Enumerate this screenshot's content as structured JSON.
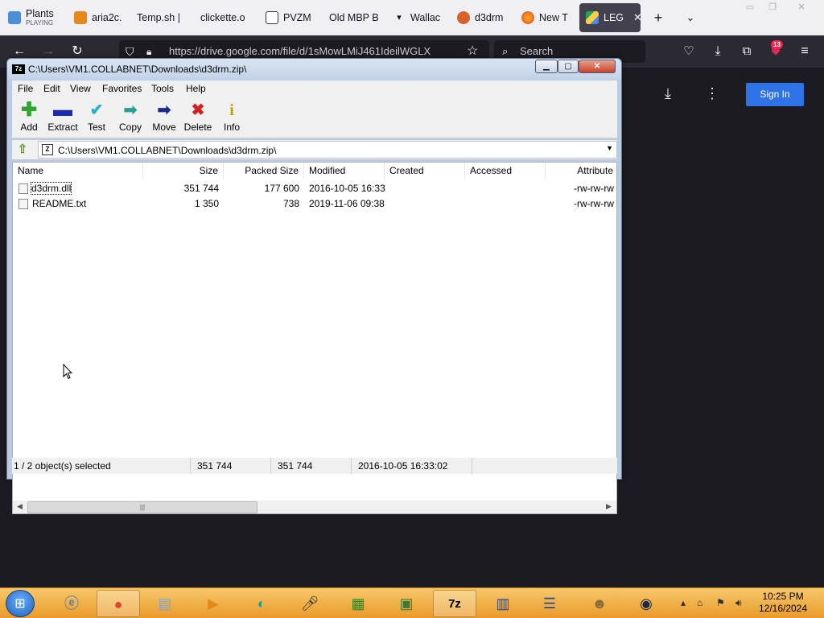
{
  "browser": {
    "tabs": [
      {
        "label": "Plants",
        "sublabel": "PLAYING",
        "icon": "game-icon",
        "active": false
      },
      {
        "label": "aria2c.",
        "icon": "shield-icon",
        "active": false
      },
      {
        "label": "Temp.sh | ",
        "icon": "none",
        "active": false
      },
      {
        "label": "clickette.o",
        "icon": "none",
        "active": false
      },
      {
        "label": "PVZM",
        "icon": "binary-icon",
        "active": false
      },
      {
        "label": "Old MBP B",
        "icon": "none",
        "active": false
      },
      {
        "label": "Wallac",
        "icon": "bird-icon",
        "active": false
      },
      {
        "label": "d3drm",
        "icon": "gear-icon",
        "active": false
      },
      {
        "label": "New T",
        "icon": "firefox-icon",
        "active": false
      },
      {
        "label": "LEG",
        "icon": "drive-icon",
        "active": true
      }
    ],
    "url": "https://drive.google.com/file/d/1sMowLMiJ461IdeilWGLX",
    "search_placeholder": "Search",
    "extensions_badge": "13"
  },
  "page": {
    "signin_label": "Sign In"
  },
  "sevenzip": {
    "title": "C:\\Users\\VM1.COLLABNET\\Downloads\\d3drm.zip\\",
    "app_icon_text": "7z",
    "menu": [
      "File",
      "Edit",
      "View",
      "Favorites",
      "Tools",
      "Help"
    ],
    "toolbar": [
      {
        "label": "Add",
        "icon": "plus-icon",
        "color": "#2fa52f"
      },
      {
        "label": "Extract",
        "icon": "minus-icon",
        "color": "#1a2aa8"
      },
      {
        "label": "Test",
        "icon": "checkmark-icon",
        "color": "#2bb0c9"
      },
      {
        "label": "Copy",
        "icon": "arrow-right-icon",
        "color": "#2a9e8e"
      },
      {
        "label": "Move",
        "icon": "arrow-right-icon",
        "color": "#1a2a8a"
      },
      {
        "label": "Delete",
        "icon": "x-icon",
        "color": "#d42020"
      },
      {
        "label": "Info",
        "icon": "info-icon",
        "color": "#c8a000"
      }
    ],
    "path": "C:\\Users\\VM1.COLLABNET\\Downloads\\d3drm.zip\\",
    "columns": [
      "Name",
      "Size",
      "Packed Size",
      "Modified",
      "Created",
      "Accessed",
      "Attribute"
    ],
    "files": [
      {
        "name": "d3drm.dll",
        "size": "351 744",
        "packed": "177 600",
        "modified": "2016-10-05 16:33",
        "created": "",
        "accessed": "",
        "attributes": "-rw-rw-rw",
        "selected": true
      },
      {
        "name": "README.txt",
        "size": "1 350",
        "packed": "738",
        "modified": "2019-11-06 09:38",
        "created": "",
        "accessed": "",
        "attributes": "-rw-rw-rw",
        "selected": false
      }
    ],
    "status": {
      "selection": "1 / 2 object(s) selected",
      "size": "351 744",
      "packed": "351 744",
      "modified": "2016-10-05 16:33:02"
    }
  },
  "taskbar": {
    "clock_time": "10:25 PM",
    "clock_date": "12/16/2024"
  }
}
